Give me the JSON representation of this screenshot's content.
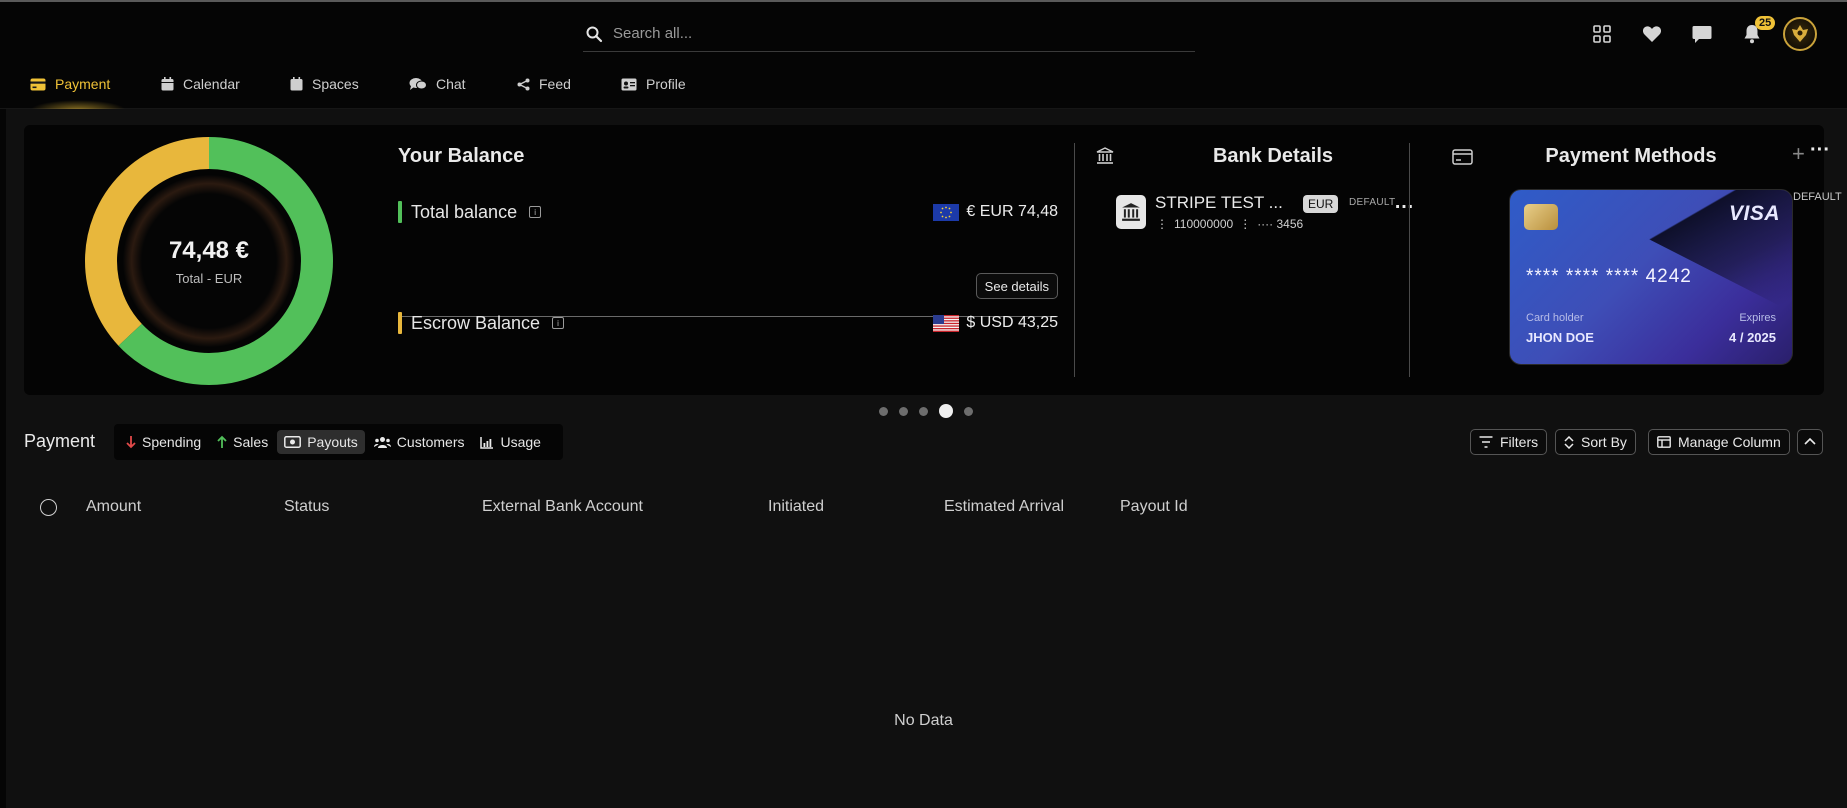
{
  "search": {
    "placeholder": "Search all..."
  },
  "top_icons": [
    "grid-icon",
    "heart-icon",
    "chat-bubble-icon",
    "bell-icon"
  ],
  "notifications": {
    "count": "25"
  },
  "nav": {
    "tabs": [
      {
        "label": "Payment",
        "icon": "credit-card-icon",
        "active": true
      },
      {
        "label": "Calendar",
        "icon": "calendar-icon"
      },
      {
        "label": "Spaces",
        "icon": "spaces-icon"
      },
      {
        "label": "Chat",
        "icon": "chat-icon"
      },
      {
        "label": "Feed",
        "icon": "share-icon"
      },
      {
        "label": "Profile",
        "icon": "id-card-icon"
      }
    ]
  },
  "colors": {
    "accent": "#f0c237",
    "green": "#52c05a",
    "yellow": "#e8b73c",
    "card_blue": "#3e4eb7"
  },
  "donut": {
    "amount": "74,48 €",
    "subtitle": "Total - EUR",
    "segments": [
      {
        "name": "green",
        "fraction": 0.63
      },
      {
        "name": "yellow",
        "fraction": 0.37
      }
    ]
  },
  "balance": {
    "title": "Your Balance",
    "total_label": "Total balance",
    "total_value": "€ EUR 74,48",
    "see_details": "See details",
    "escrow_label": "Escrow Balance",
    "escrow_value": "$ USD 43,25"
  },
  "bank": {
    "title": "Bank Details",
    "name": "STRIPE TEST ...",
    "currency": "EUR",
    "default_label": "DEFAULT",
    "routing": "110000000",
    "account": "···· 3456"
  },
  "payment_methods": {
    "title": "Payment Methods",
    "default_label": "DEFAULT",
    "card": {
      "brand": "VISA",
      "number": "**** **** **** 4242",
      "holder_label": "Card holder",
      "holder": "JHON DOE",
      "expires_label": "Expires",
      "expires": "4 / 2025"
    }
  },
  "carousel": {
    "count": 5,
    "active_index": 3
  },
  "payment_section": {
    "title": "Payment",
    "segments": [
      {
        "label": "Spending",
        "icon": "arrow-down-icon"
      },
      {
        "label": "Sales",
        "icon": "arrow-up-icon"
      },
      {
        "label": "Payouts",
        "icon": "money-icon",
        "active": true
      },
      {
        "label": "Customers",
        "icon": "users-icon"
      },
      {
        "label": "Usage",
        "icon": "chart-icon"
      }
    ],
    "filters": "Filters",
    "sort_by": "Sort By",
    "manage_column": "Manage Column"
  },
  "table": {
    "columns": [
      "Amount",
      "Status",
      "External Bank Account",
      "Initiated",
      "Estimated Arrival",
      "Payout Id"
    ],
    "empty_text": "No Data"
  }
}
